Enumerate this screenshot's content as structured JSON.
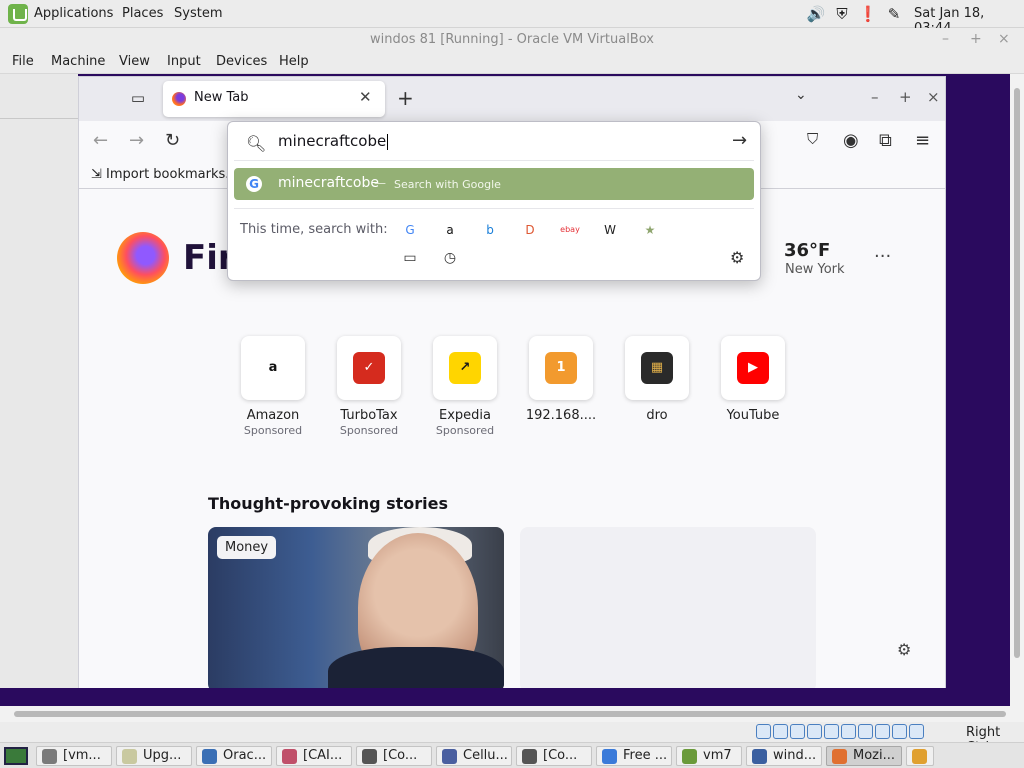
{
  "topbar": {
    "menu": [
      "Applications",
      "Places",
      "System"
    ],
    "clock": "Sat Jan 18, 03:44",
    "tray_icons": [
      "volume-icon",
      "shield-icon",
      "clipboard-icon",
      "pen-icon"
    ]
  },
  "vbox": {
    "title": "windos 81 [Running] - Oracle VM VirtualBox",
    "menu": [
      "File",
      "Machine",
      "View",
      "Input",
      "Devices",
      "Help"
    ],
    "right_ctrl": "Right Ctrl"
  },
  "firefox": {
    "tab_label": "New Tab",
    "bookmark": "Import bookmarks...",
    "urlbar": {
      "query": "minecraftcobe",
      "suggestion": "minecraftcobe",
      "suggestion_sep": "—",
      "suggestion_action": "Search with Google",
      "this_time": "This time, search with:",
      "engines": [
        {
          "name": "google",
          "glyph": "G",
          "color": "#4285f4"
        },
        {
          "name": "amazon",
          "glyph": "a",
          "color": "#111111"
        },
        {
          "name": "bing",
          "glyph": "b",
          "color": "#1a7fd9"
        },
        {
          "name": "duckduckgo",
          "glyph": "D",
          "color": "#de5833"
        },
        {
          "name": "ebay",
          "glyph": "ebay",
          "color": "#e53238"
        },
        {
          "name": "wikipedia",
          "glyph": "W",
          "color": "#222222"
        },
        {
          "name": "bookmark-star",
          "glyph": "★",
          "color": "#8fa66f"
        }
      ]
    },
    "brand": "Fire",
    "weather": {
      "temp": "36°F",
      "city": "New York"
    },
    "shortcuts": [
      {
        "name": "Amazon",
        "sponsored": "Sponsored",
        "glyph": "a",
        "bg": "#ffffff",
        "fg": "#111111"
      },
      {
        "name": "TurboTax",
        "sponsored": "Sponsored",
        "glyph": "✓",
        "bg": "#d52b1e",
        "fg": "#ffffff"
      },
      {
        "name": "Expedia",
        "sponsored": "Sponsored",
        "glyph": "↗",
        "bg": "#ffd500",
        "fg": "#1a1a1a"
      },
      {
        "name": "192.168....",
        "sponsored": "",
        "glyph": "1",
        "bg": "#f29a2e",
        "fg": "#ffffff"
      },
      {
        "name": "dro",
        "sponsored": "",
        "glyph": "▦",
        "bg": "#2a2a2a",
        "fg": "#e2b04a"
      },
      {
        "name": "YouTube",
        "sponsored": "",
        "glyph": "▶",
        "bg": "#ff0000",
        "fg": "#ffffff"
      }
    ],
    "stories_title": "Thought-provoking stories",
    "story_tag": "Money"
  },
  "taskbar": [
    {
      "label": "[vm...",
      "color": "#7a7a7a"
    },
    {
      "label": "Upg...",
      "color": "#c9c9a0"
    },
    {
      "label": "Orac...",
      "color": "#3a6fb5"
    },
    {
      "label": "[CAI...",
      "color": "#c0506a"
    },
    {
      "label": "[Co...",
      "color": "#555555"
    },
    {
      "label": "Cellu...",
      "color": "#4a5fa0"
    },
    {
      "label": "[Co...",
      "color": "#555555"
    },
    {
      "label": "Free ...",
      "color": "#3a7ad9"
    },
    {
      "label": "vm7",
      "color": "#6a9a3a"
    },
    {
      "label": "wind...",
      "color": "#3a5fa0"
    },
    {
      "label": "Mozi...",
      "color": "#e07030"
    }
  ]
}
